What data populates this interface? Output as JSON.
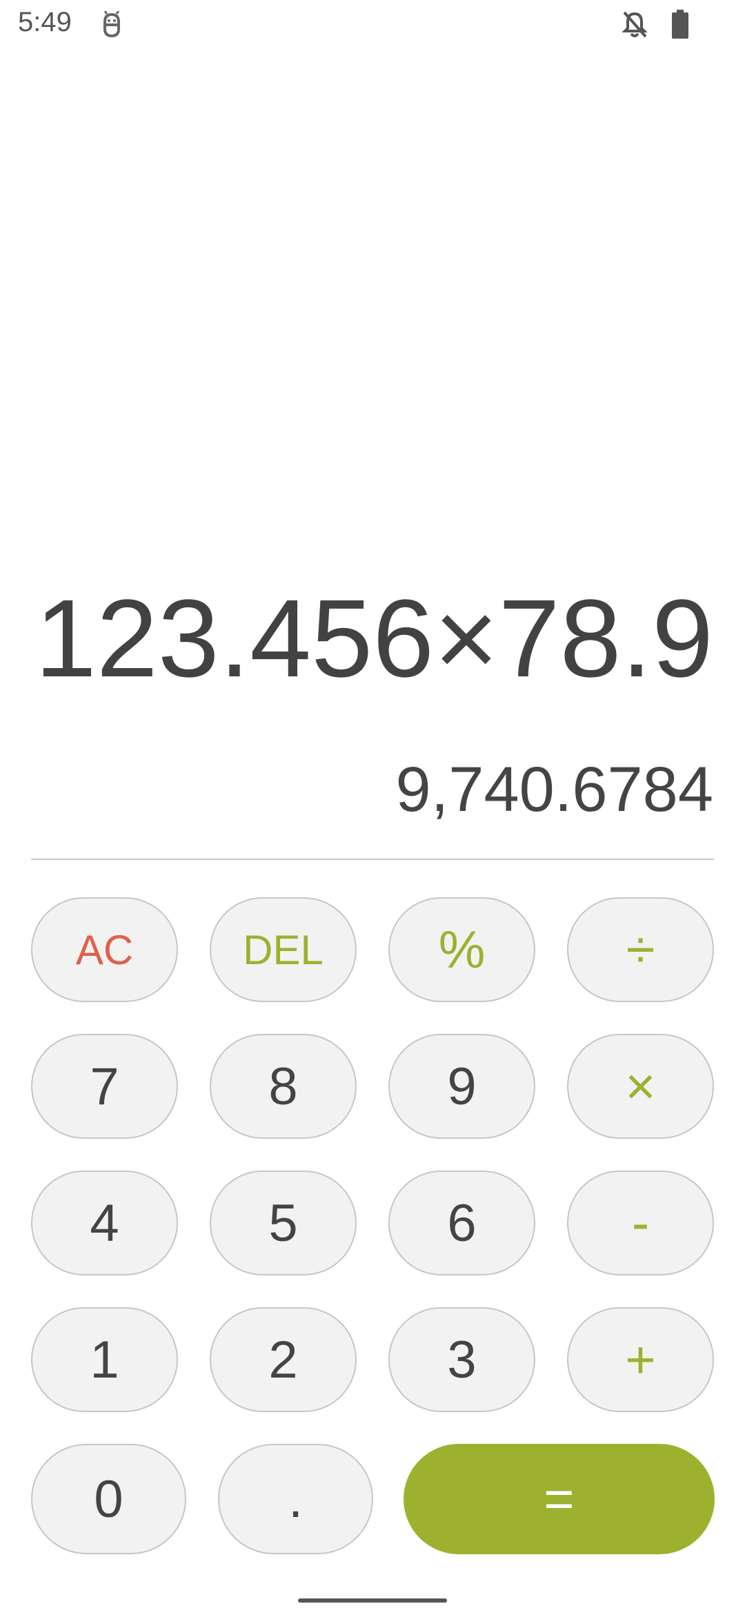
{
  "status_bar": {
    "time": "5:49",
    "app_icon": "android-debug-icon",
    "bell_icon": "notifications-off-icon",
    "battery_icon": "battery-full-icon"
  },
  "display": {
    "expression": "123.456×78.9",
    "result": "9,740.6784"
  },
  "keypad": {
    "row1": [
      "AC",
      "DEL",
      "%",
      "÷"
    ],
    "row2": [
      "7",
      "8",
      "9",
      "×"
    ],
    "row3": [
      "4",
      "5",
      "6",
      "-"
    ],
    "row4": [
      "1",
      "2",
      "3",
      "+"
    ],
    "row5": [
      "0",
      ".",
      "="
    ]
  },
  "colors": {
    "accent": "#9db12f",
    "clear": "#e0604a",
    "key_background": "#f2f2f2",
    "key_border": "#c6c6c6",
    "text": "#444444"
  }
}
